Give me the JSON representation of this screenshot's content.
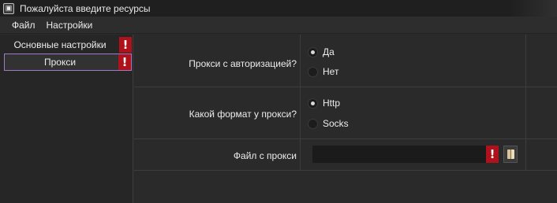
{
  "window": {
    "title": "Пожалуйста введите ресурсы",
    "icon": "app-icon"
  },
  "menu": {
    "items": [
      "Файл",
      "Настройки"
    ]
  },
  "sidebar": {
    "items": [
      {
        "label": "Основные настройки",
        "warning": "!",
        "active": false
      },
      {
        "label": "Прокси",
        "warning": "!",
        "active": true
      }
    ]
  },
  "form": {
    "auth": {
      "label": "Прокси с авторизацией?",
      "options": [
        {
          "label": "Да",
          "checked": true
        },
        {
          "label": "Нет",
          "checked": false
        }
      ]
    },
    "format": {
      "label": "Какой формат у прокси?",
      "options": [
        {
          "label": "Http",
          "checked": true
        },
        {
          "label": "Socks",
          "checked": false
        }
      ]
    },
    "file": {
      "label": "Файл с прокси",
      "value": "",
      "warning": "!",
      "browse_icon": "book-icon"
    }
  },
  "colors": {
    "warning": "#b0121b",
    "active_border": "#a07ac8",
    "background": "#2b2b2b"
  }
}
